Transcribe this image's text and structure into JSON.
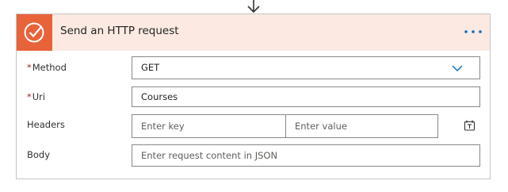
{
  "action": {
    "title": "Send an HTTP request",
    "icon": "http-request-icon",
    "more_icon": "more-options-icon",
    "accent_color": "#e8623a",
    "header_bg": "#fbe9e2"
  },
  "fields": {
    "method": {
      "label": "Method",
      "required_mark": "*",
      "value": "GET",
      "icon": "chevron-down-icon"
    },
    "uri": {
      "label": "Uri",
      "required_mark": "*",
      "value": "Courses"
    },
    "headers": {
      "label": "Headers",
      "key_placeholder": "Enter key",
      "value_placeholder": "Enter value",
      "mode_icon": "switch-to-text-mode-icon"
    },
    "body": {
      "label": "Body",
      "placeholder": "Enter request content in JSON"
    }
  }
}
